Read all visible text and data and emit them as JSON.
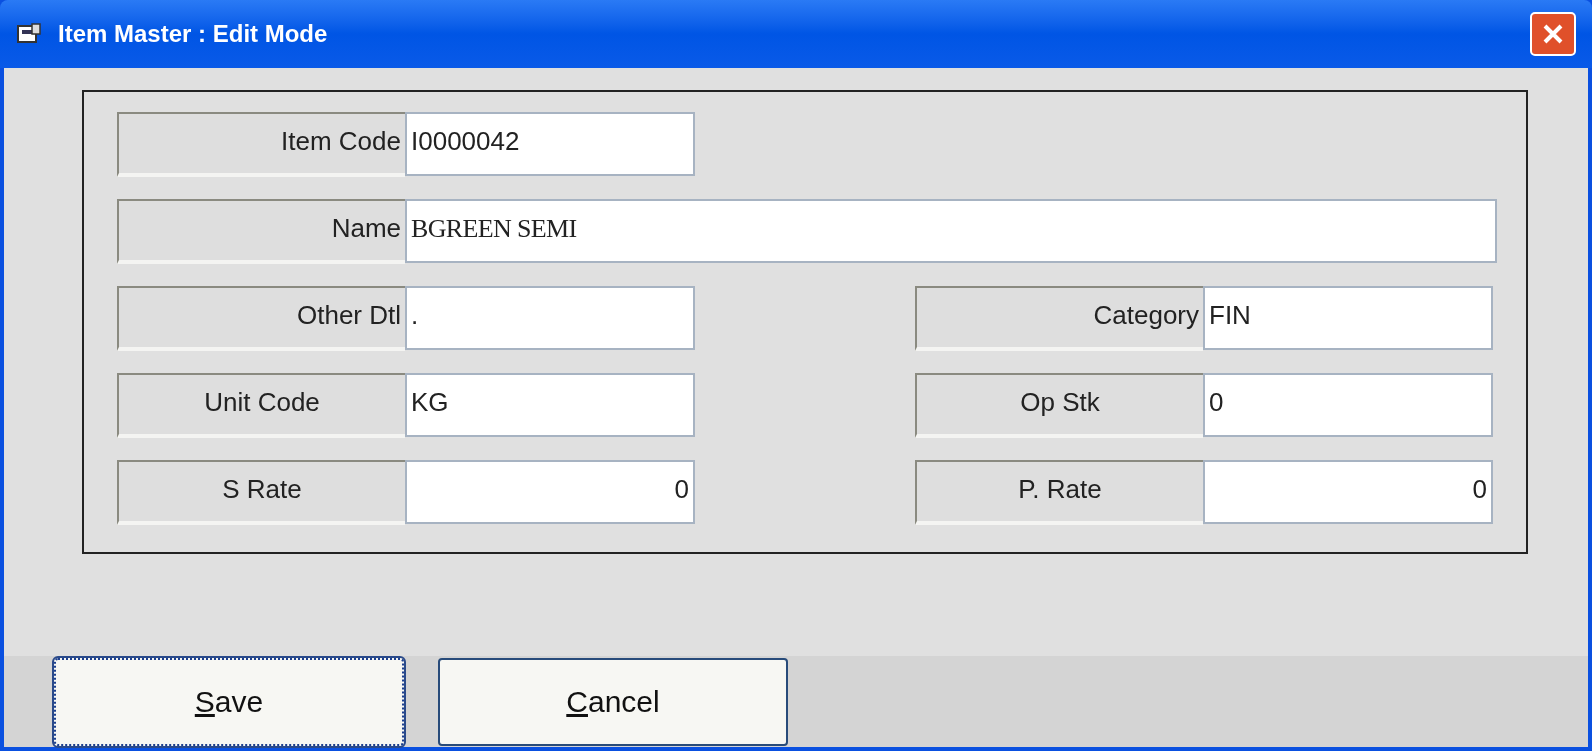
{
  "window": {
    "title": "Item Master : Edit Mode"
  },
  "rows": [
    {
      "fields": [
        {
          "label": "Item Code",
          "value": "I0000042",
          "kind": "short"
        }
      ]
    },
    {
      "fields": [
        {
          "label": "Name",
          "value": "BGREEN SEMI",
          "kind": "wide"
        }
      ]
    },
    {
      "fields": [
        {
          "label": "Other Dtl",
          "value": ".",
          "kind": "short"
        },
        {
          "label": "Category",
          "value": "FIN",
          "kind": "short"
        }
      ]
    },
    {
      "fields": [
        {
          "label": "Unit Code",
          "value": "KG",
          "kind": "centered"
        },
        {
          "label": "Op Stk",
          "value": "0",
          "kind": "centered"
        }
      ]
    },
    {
      "fields": [
        {
          "label": "S Rate",
          "value": "0",
          "kind": "amount"
        },
        {
          "label": "P. Rate",
          "value": "0",
          "kind": "amount"
        }
      ]
    }
  ],
  "buttons": [
    {
      "label": "Save",
      "focused": true
    },
    {
      "label": "Cancel",
      "focused": false
    }
  ]
}
